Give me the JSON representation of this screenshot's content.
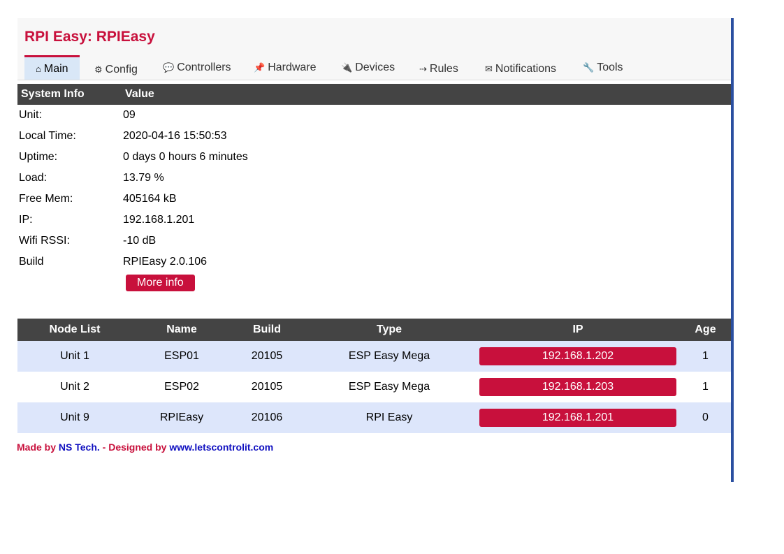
{
  "header": {
    "title": "RPI Easy: RPIEasy"
  },
  "tabs": [
    {
      "label": "Main",
      "icon": "⌂"
    },
    {
      "label": "Config",
      "icon": "⚙"
    },
    {
      "label": "Controllers",
      "icon": "💬"
    },
    {
      "label": "Hardware",
      "icon": "📌"
    },
    {
      "label": "Devices",
      "icon": "🔌"
    },
    {
      "label": "Rules",
      "icon": "⇢"
    },
    {
      "label": "Notifications",
      "icon": "✉"
    },
    {
      "label": "Tools",
      "icon": "🔧"
    }
  ],
  "sysinfo": {
    "headers": [
      "System Info",
      "Value"
    ],
    "rows": [
      {
        "label": "Unit:",
        "value": "09"
      },
      {
        "label": "Local Time:",
        "value": "2020-04-16 15:50:53"
      },
      {
        "label": "Uptime:",
        "value": "0 days 0 hours 6 minutes"
      },
      {
        "label": "Load:",
        "value": "13.79 %"
      },
      {
        "label": "Free Mem:",
        "value": "405164 kB"
      },
      {
        "label": "IP:",
        "value": "192.168.1.201"
      },
      {
        "label": "Wifi RSSI:",
        "value": "-10 dB"
      },
      {
        "label": "Build",
        "value": "RPIEasy 2.0.106"
      }
    ],
    "more_info_label": "More info"
  },
  "nodes": {
    "headers": [
      "Node List",
      "Name",
      "Build",
      "Type",
      "IP",
      "Age"
    ],
    "rows": [
      {
        "unit": "Unit 1",
        "name": "ESP01",
        "build": "20105",
        "type": "ESP Easy Mega",
        "ip": "192.168.1.202",
        "age": "1"
      },
      {
        "unit": "Unit 2",
        "name": "ESP02",
        "build": "20105",
        "type": "ESP Easy Mega",
        "ip": "192.168.1.203",
        "age": "1"
      },
      {
        "unit": "Unit 9",
        "name": "RPIEasy",
        "build": "20106",
        "type": "RPI Easy",
        "ip": "192.168.1.201",
        "age": "0"
      }
    ]
  },
  "footer": {
    "made_by": "Made by ",
    "ns_tech": "NS Tech.",
    "designed_by": " - Designed by ",
    "site": "www.letscontrolit.com"
  },
  "colors": {
    "accent": "#c8103c",
    "header_bg": "#444444",
    "row_alt": "#dde6fb",
    "tab_active": "#d9e7f7",
    "link": "#1010c0"
  }
}
